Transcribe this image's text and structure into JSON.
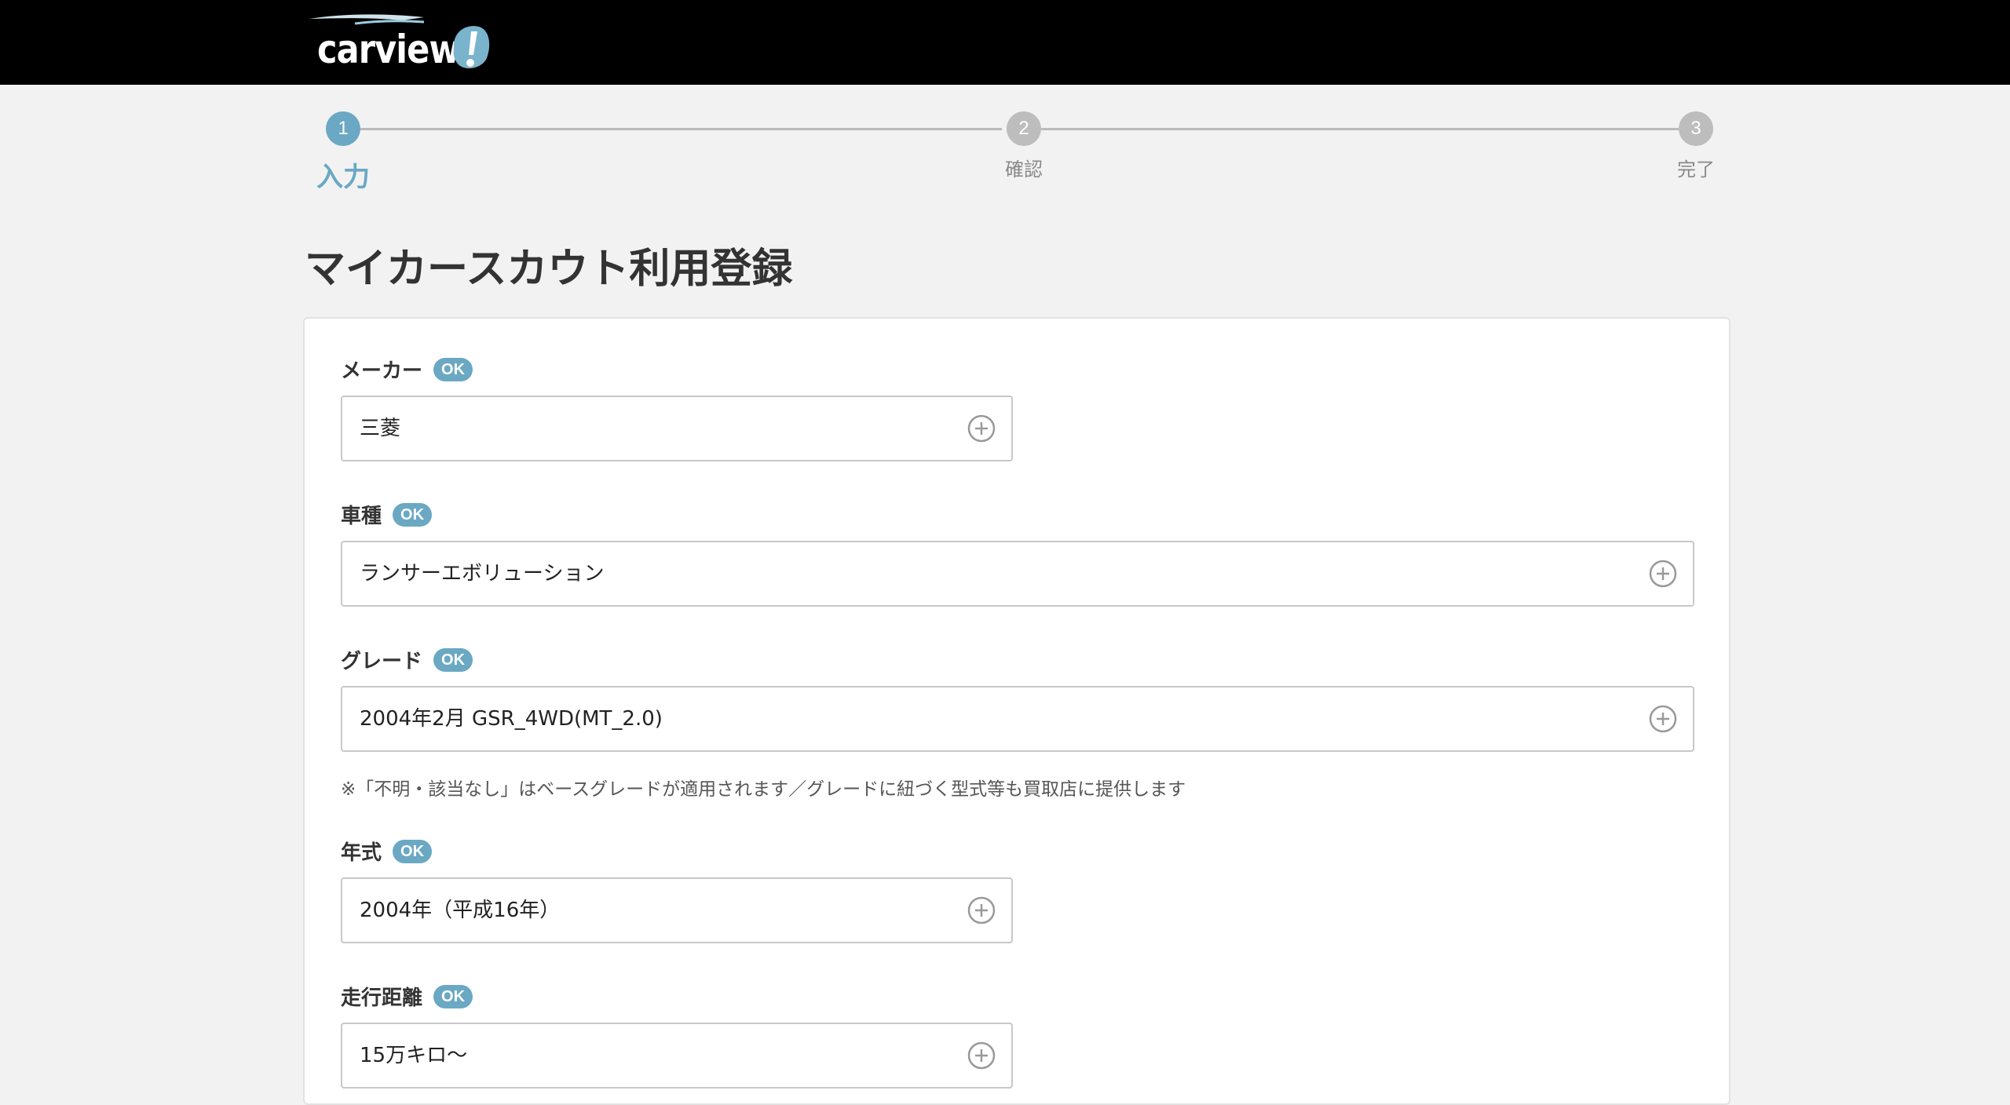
{
  "brand": {
    "logo_text": "carview",
    "logo_mark": "!"
  },
  "stepper": {
    "steps": [
      {
        "number": "1",
        "label": "入力",
        "state": "active"
      },
      {
        "number": "2",
        "label": "確認",
        "state": "inactive"
      },
      {
        "number": "3",
        "label": "完了",
        "state": "inactive"
      }
    ]
  },
  "page_title": "マイカースカウト利用登録",
  "badge_text": "OK",
  "fields": {
    "maker": {
      "label": "メーカー",
      "value": "三菱"
    },
    "model": {
      "label": "車種",
      "value": "ランサーエボリューション"
    },
    "grade": {
      "label": "グレード",
      "value": "2004年2月 GSR_4WD(MT_2.0)"
    },
    "grade_note": "※「不明・該当なし」はベースグレードが適用されます／グレードに紐づく型式等も買取店に提供します",
    "year": {
      "label": "年式",
      "value": "2004年（平成16年）"
    },
    "mileage": {
      "label": "走行距離",
      "value": "15万キロ〜"
    }
  },
  "colors": {
    "accent": "#6aa8c4",
    "header_bg": "#000000",
    "page_bg": "#f2f2f2"
  },
  "icons": {
    "select_expand": "plus-circle-icon"
  }
}
